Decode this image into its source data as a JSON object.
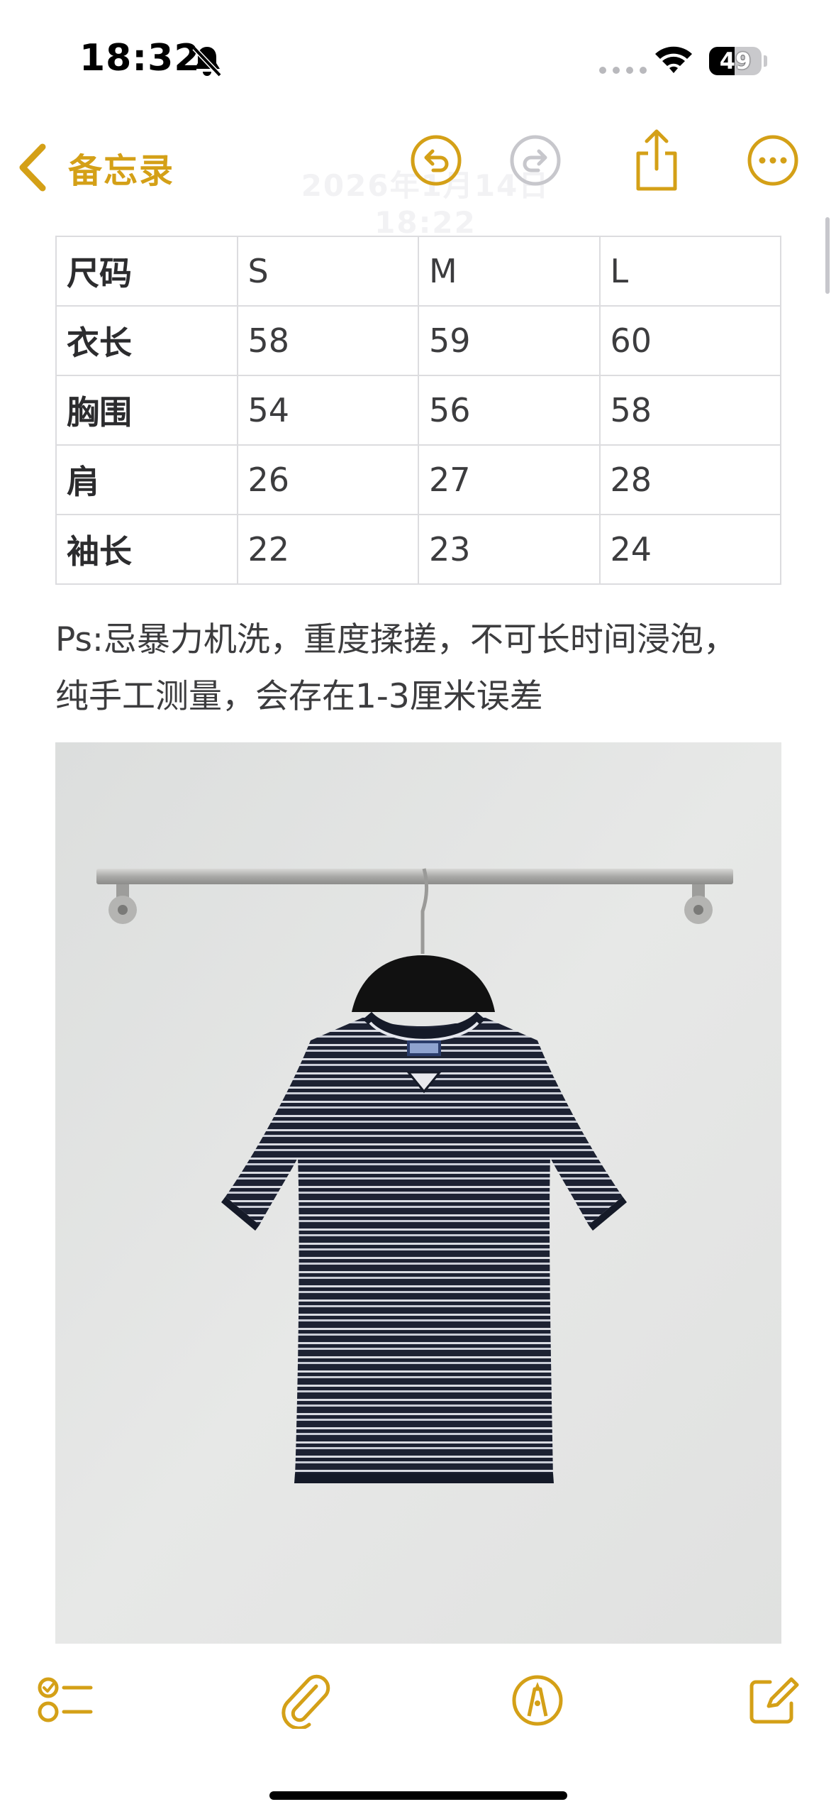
{
  "status_bar": {
    "time": "18:32",
    "battery_percent": 49,
    "battery_label": "49",
    "bell_icon": "bell-slash-icon",
    "wifi_icon": "wifi-icon"
  },
  "nav": {
    "back_label": "备忘录",
    "date_text": "2026年1月14日 18:22",
    "icons": [
      "chevron-left-icon",
      "undo-icon",
      "redo-icon",
      "share-icon",
      "ellipsis-circle-icon"
    ]
  },
  "size_table": {
    "rows": [
      [
        "尺码",
        "S",
        "M",
        "L"
      ],
      [
        "衣长",
        "58",
        "59",
        "60"
      ],
      [
        "胸围",
        "54",
        "56",
        "58"
      ],
      [
        "肩",
        "26",
        "27",
        "28"
      ],
      [
        "袖长",
        "22",
        "23",
        "24"
      ]
    ]
  },
  "note": {
    "line1": "Ps:忌暴力机洗，重度揉搓，不可长时间浸泡，",
    "line2": "纯手工测量，会存在1-3厘米误差"
  },
  "toolbar": {
    "icons": [
      "checklist-icon",
      "paperclip-icon",
      "markup-pen-icon",
      "compose-icon"
    ]
  },
  "colors": {
    "accent": "#d4a017",
    "disabled": "#c7c7cc",
    "table_border": "#dcdcdf",
    "text": "#3c3c3e"
  }
}
